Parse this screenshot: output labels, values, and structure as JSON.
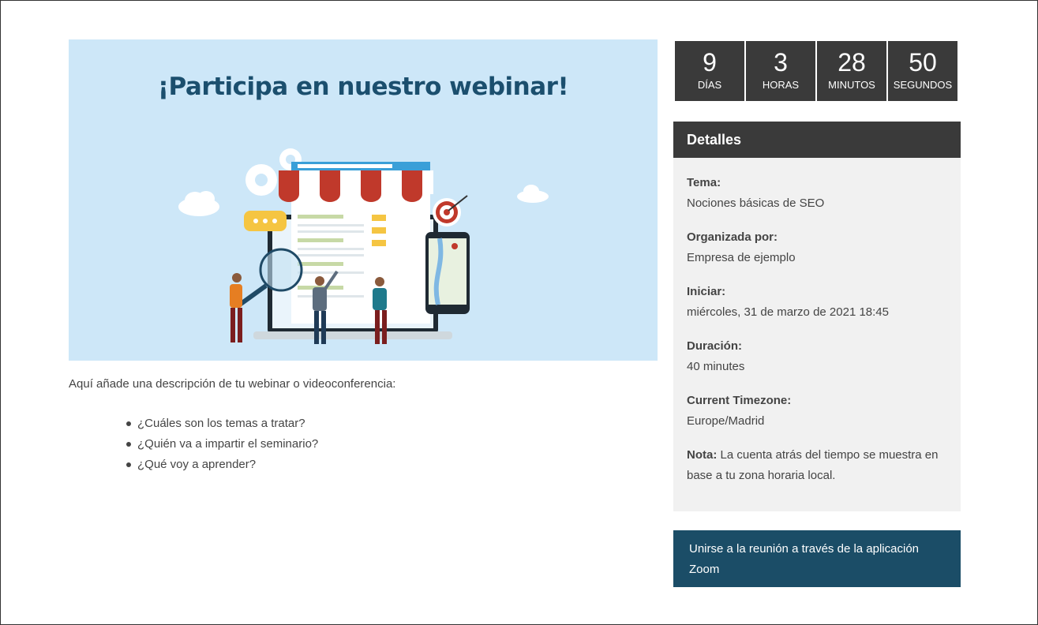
{
  "banner": {
    "title": "¡Participa en nuestro webinar!"
  },
  "description": "Aquí añade una descripción de tu webinar o videoconferencia:",
  "bullets": [
    "¿Cuáles son los temas a tratar?",
    "¿Quién va a impartir el seminario?",
    "¿Qué voy a aprender?"
  ],
  "countdown": [
    {
      "value": "9",
      "label": "DÍAS"
    },
    {
      "value": "3",
      "label": "HORAS"
    },
    {
      "value": "28",
      "label": "MINUTOS"
    },
    {
      "value": "50",
      "label": "SEGUNDOS"
    }
  ],
  "details": {
    "heading": "Detalles",
    "topic_label": "Tema:",
    "topic_value": "Nociones básicas de SEO",
    "organizer_label": "Organizada por:",
    "organizer_value": "Empresa de ejemplo",
    "start_label": "Iniciar:",
    "start_value": "miércoles, 31 de marzo de 2021 18:45",
    "duration_label": "Duración:",
    "duration_value": "40 minutes",
    "timezone_label": "Current Timezone:",
    "timezone_value": "Europe/Madrid",
    "note_label": "Nota:",
    "note_text": " La cuenta atrás del tiempo se muestra en base a tu zona horaria local."
  },
  "join_button": "Unirse a la reunión a través de la aplicación Zoom",
  "colors": {
    "banner_bg": "#cde7f8",
    "title": "#1b4f6e",
    "dark": "#3a3a3a",
    "button": "#1b4d67"
  }
}
